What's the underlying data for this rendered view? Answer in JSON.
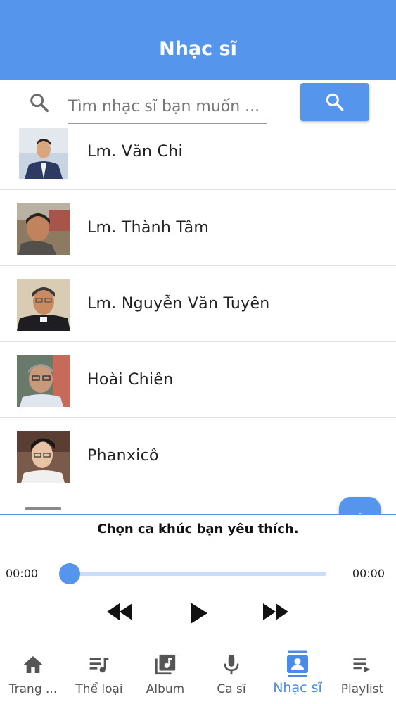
{
  "app_bar": {
    "title": "Nhạc sĩ"
  },
  "search": {
    "placeholder": "Tìm nhạc sĩ bạn muốn ..."
  },
  "composers": [
    {
      "name": "Lm. Văn Chi"
    },
    {
      "name": "Lm. Thành Tâm"
    },
    {
      "name": "Lm. Nguyễn Văn Tuyên"
    },
    {
      "name": "Hoài Chiên"
    },
    {
      "name": "Phanxicô"
    }
  ],
  "player": {
    "now_playing": "Chọn ca khúc bạn yêu thích.",
    "current_time": "00:00",
    "total_time": "00:00",
    "progress": 0
  },
  "bottom_nav": {
    "items": [
      {
        "label": "Trang ...",
        "icon": "home-icon"
      },
      {
        "label": "Thể loại",
        "icon": "genre-icon"
      },
      {
        "label": "Album",
        "icon": "album-icon"
      },
      {
        "label": "Ca sĩ",
        "icon": "microphone-icon"
      },
      {
        "label": "Nhạc sĩ",
        "icon": "contact-card-icon",
        "active": true
      },
      {
        "label": "Playlist",
        "icon": "playlist-icon"
      }
    ]
  },
  "colors": {
    "accent": "#5595ec",
    "active_nav": "#4a8ae8",
    "track": "#c9dcf8"
  }
}
